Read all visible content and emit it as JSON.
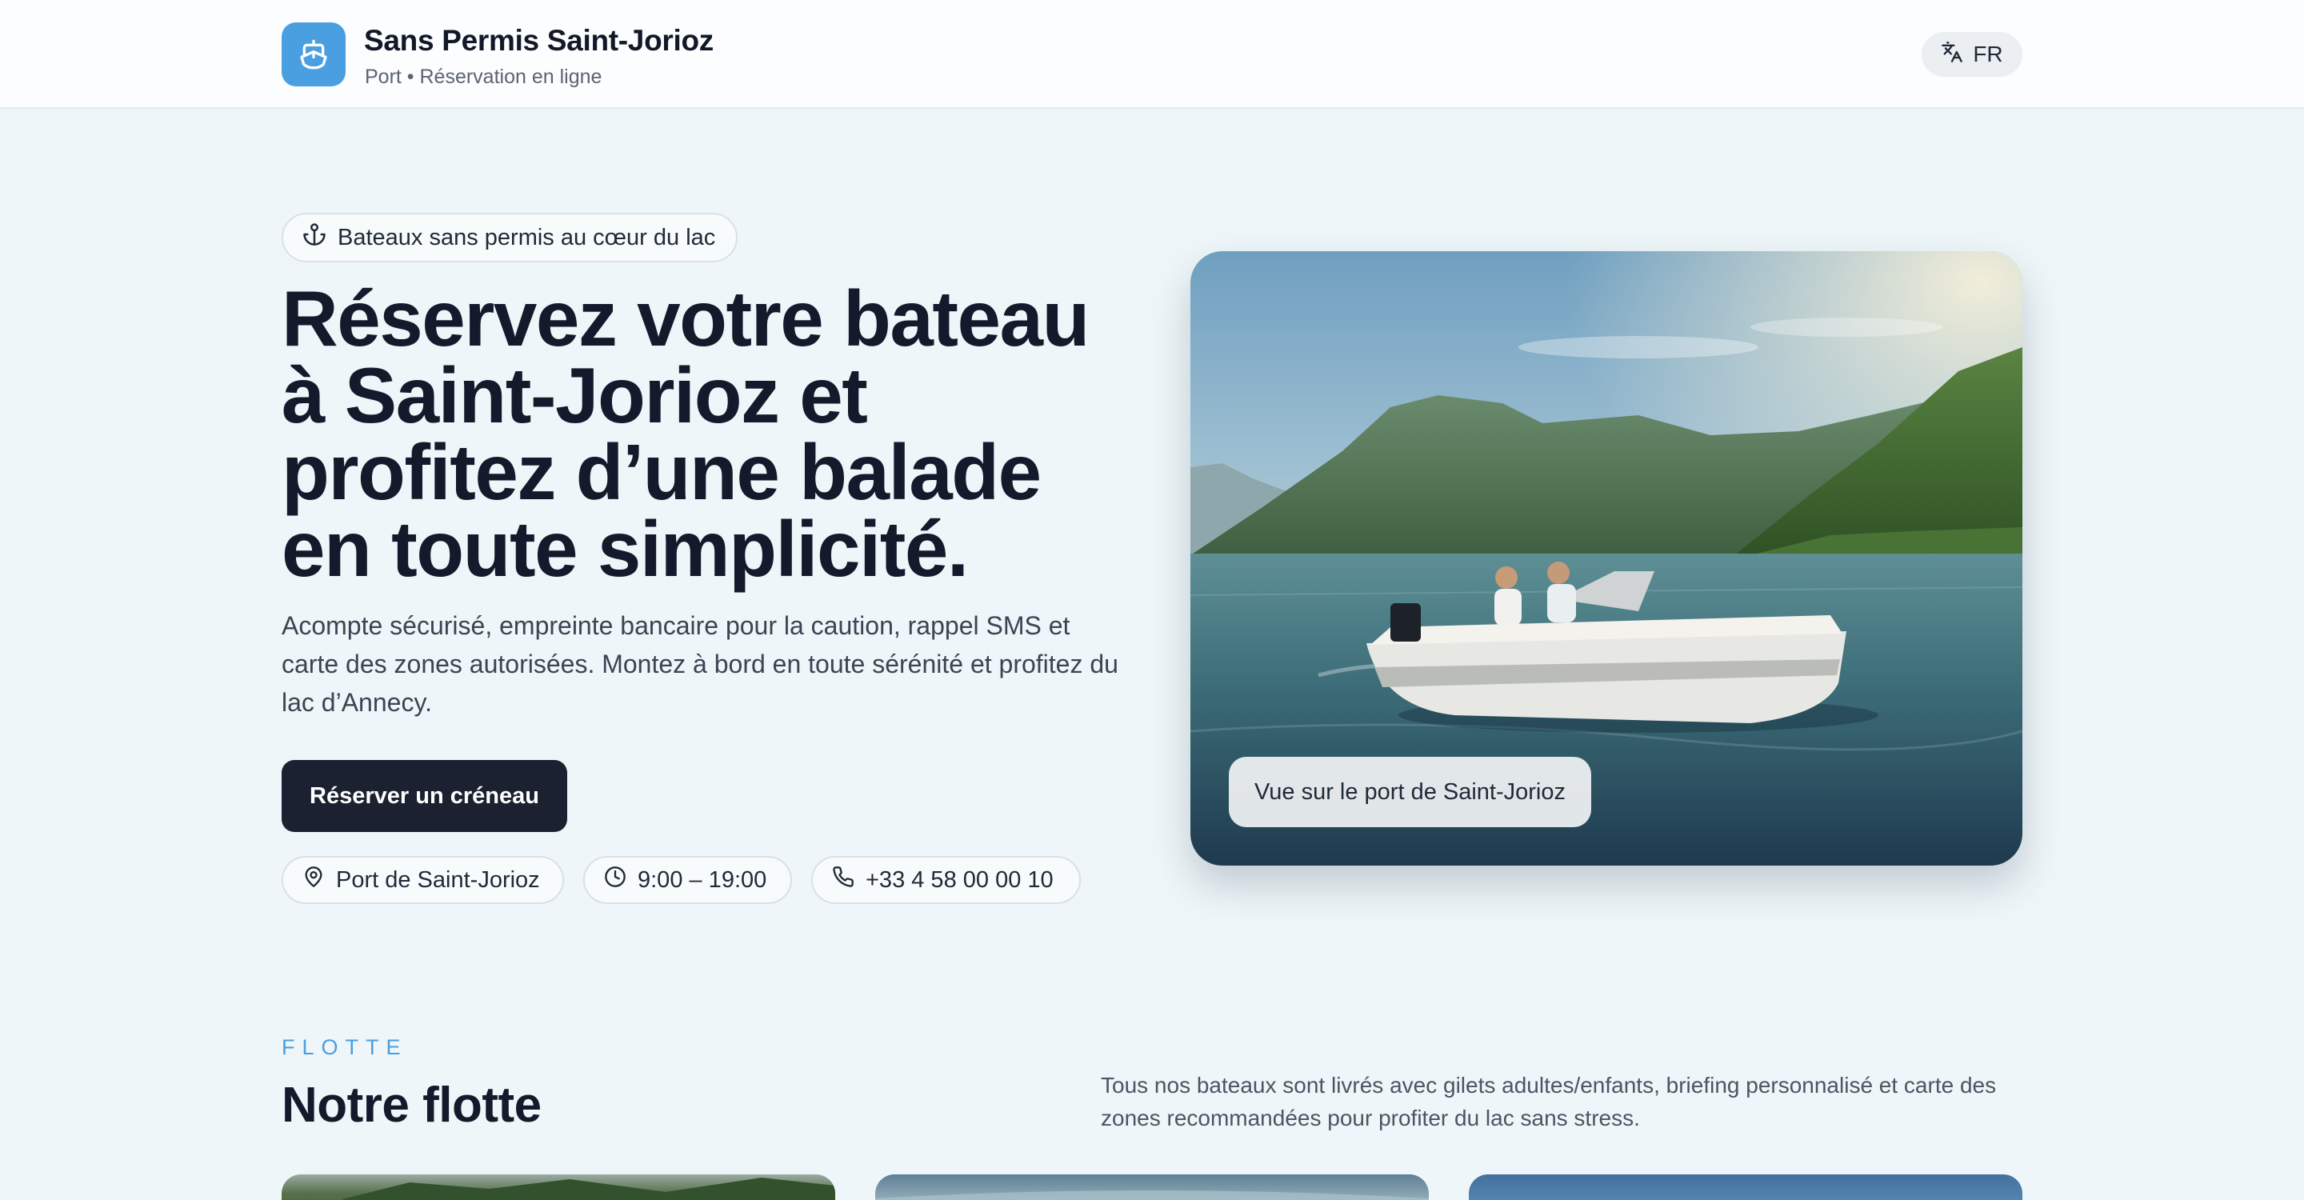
{
  "header": {
    "brand_title": "Sans Permis Saint-Jorioz",
    "brand_subtitle": "Port • Réservation en ligne",
    "language": "FR"
  },
  "hero": {
    "badge": "Bateaux sans permis au cœur du lac",
    "title": "Réservez votre bateau à Saint-Jorioz et profitez d’une balade en toute simplicité.",
    "description": "Acompte sécurisé, empreinte bancaire pour la caution, rappel SMS et carte des zones autorisées. Montez à bord en toute sérénité et profitez du lac d’Annecy.",
    "cta_label": "Réserver un créneau",
    "info": {
      "location": "Port de Saint-Jorioz",
      "hours": "9:00 – 19:00",
      "phone": "+33 4 58 00 00 10"
    },
    "image_caption": "Vue sur le port de Saint-Jorioz"
  },
  "fleet": {
    "eyebrow": "FLOTTE",
    "title": "Notre flotte",
    "description": "Tous nos bateaux sont livrés avec gilets adultes/enfants, briefing personnalisé et carte des zones recommandées pour profiter du lac sans stress."
  },
  "colors": {
    "accent": "#4a9fe0",
    "dark_button": "#1b2130",
    "page_background": "#eef6f9"
  },
  "icons": {
    "brand": "boat-icon",
    "language": "translate-icon",
    "badge": "anchor-icon",
    "location": "map-pin-icon",
    "hours": "clock-icon",
    "phone": "phone-icon"
  }
}
